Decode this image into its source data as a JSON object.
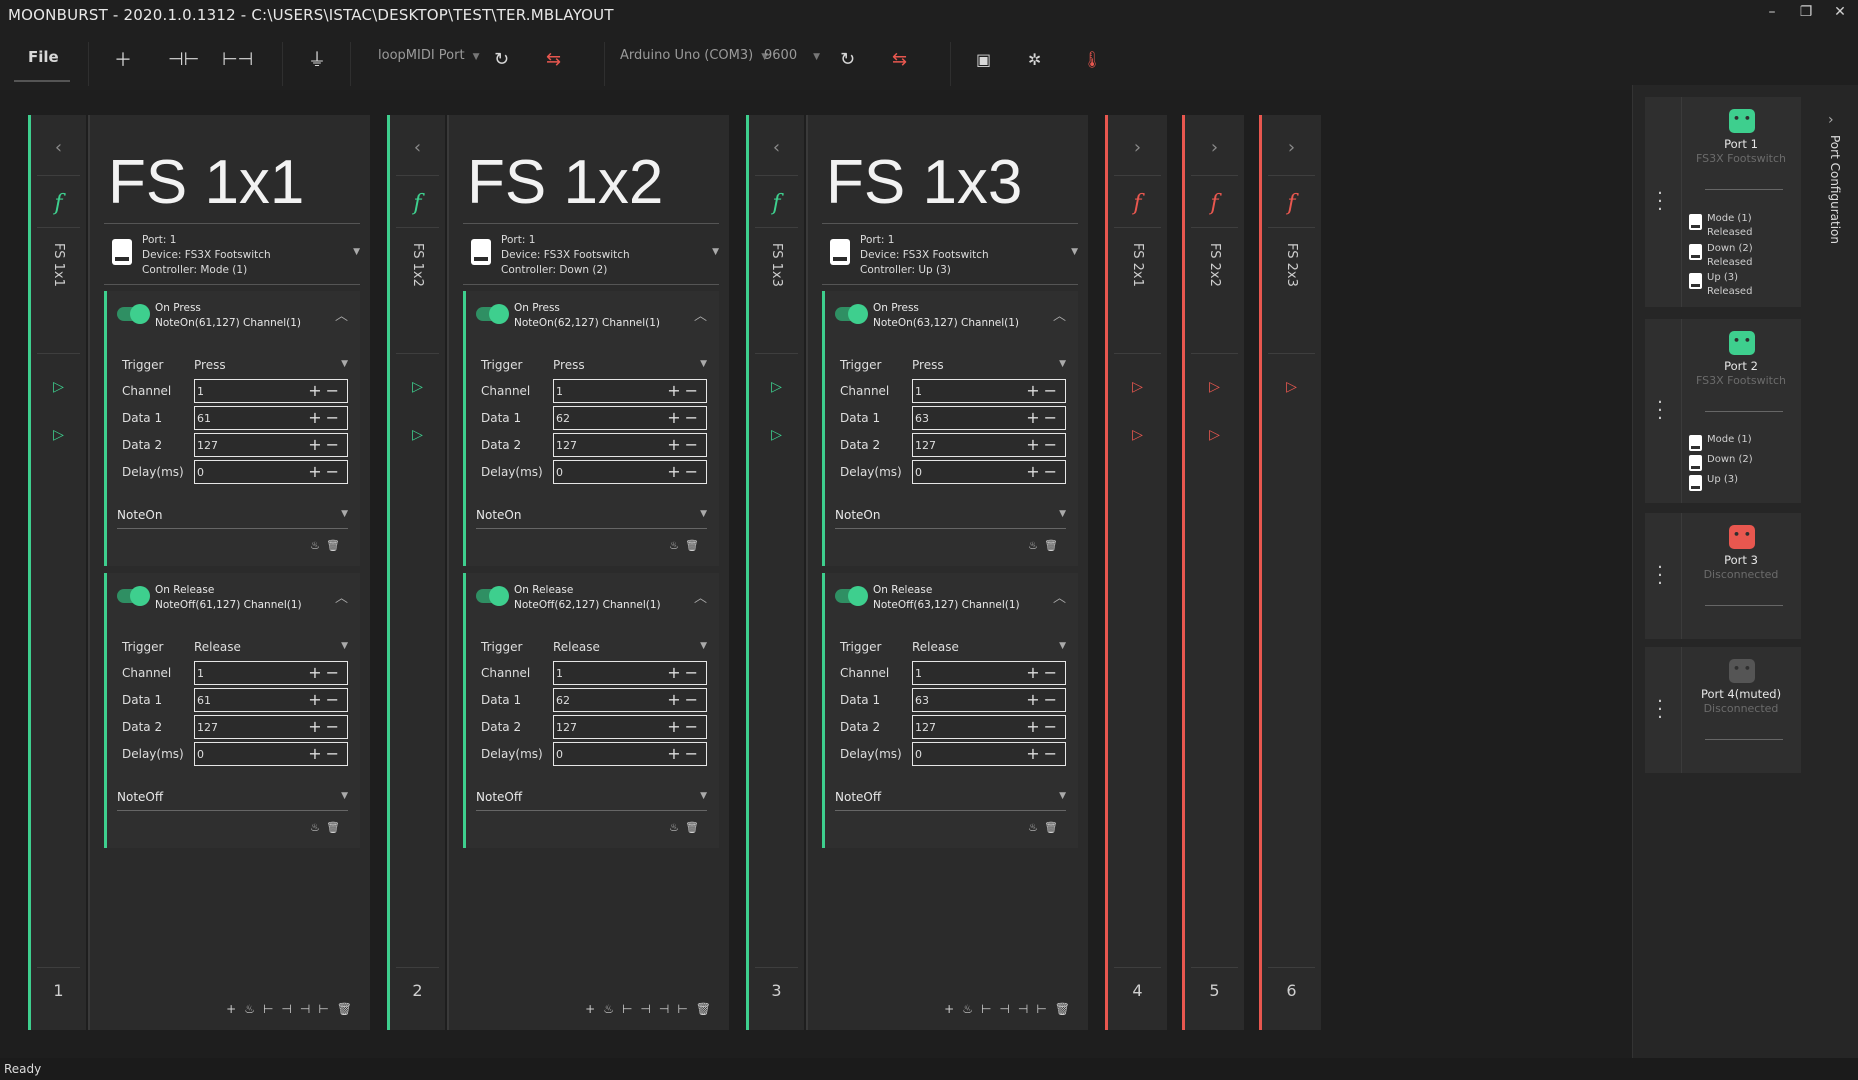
{
  "window": {
    "title": "MOONBURST - 2020.1.0.1312 - C:\\USERS\\ISTAC\\DESKTOP\\TEST\\TER.MBLAYOUT",
    "controls": [
      "–",
      "❐",
      "✕"
    ]
  },
  "toolbar": {
    "file_label": "File",
    "midi_port": "loopMIDI Port",
    "serial_port": "Arduino Uno (COM3)",
    "baud": "9600",
    "icons": [
      "add-icon",
      "split-icon",
      "fit-width-icon",
      "plug-icon",
      "refresh-icon",
      "swap-icon",
      "refresh-icon",
      "swap-icon",
      "calendar-alert-icon",
      "settings-bug-icon",
      "thermometer-icon"
    ]
  },
  "strips": [
    {
      "name": "FS 1x1",
      "number": "1",
      "state": "connected"
    },
    {
      "name": "FS 1x2",
      "number": "2",
      "state": "connected"
    },
    {
      "name": "FS 1x3",
      "number": "3",
      "state": "connected"
    },
    {
      "name": "FS 2x1",
      "number": "4",
      "state": "disconnected"
    },
    {
      "name": "FS 2x2",
      "number": "5",
      "state": "disconnected"
    },
    {
      "name": "FS 2x3",
      "number": "6",
      "state": "disconnected"
    }
  ],
  "panels": [
    {
      "title": "FS 1x1",
      "port": "Port: 1",
      "device": "Device: FS3X Footswitch",
      "controller": "Controller: Mode (1)",
      "actions": [
        {
          "name": "On Press",
          "msg": "NoteOn(61,127) Channel(1)",
          "trigger": "Press",
          "channel": "1",
          "data1": "61",
          "data2": "127",
          "delay": "0",
          "type": "NoteOn"
        },
        {
          "name": "On Release",
          "msg": "NoteOff(61,127) Channel(1)",
          "trigger": "Release",
          "channel": "1",
          "data1": "61",
          "data2": "127",
          "delay": "0",
          "type": "NoteOff"
        }
      ]
    },
    {
      "title": "FS 1x2",
      "port": "Port: 1",
      "device": "Device: FS3X Footswitch",
      "controller": "Controller: Down (2)",
      "actions": [
        {
          "name": "On Press",
          "msg": "NoteOn(62,127) Channel(1)",
          "trigger": "Press",
          "channel": "1",
          "data1": "62",
          "data2": "127",
          "delay": "0",
          "type": "NoteOn"
        },
        {
          "name": "On Release",
          "msg": "NoteOff(62,127) Channel(1)",
          "trigger": "Release",
          "channel": "1",
          "data1": "62",
          "data2": "127",
          "delay": "0",
          "type": "NoteOff"
        }
      ]
    },
    {
      "title": "FS 1x3",
      "port": "Port: 1",
      "device": "Device: FS3X Footswitch",
      "controller": "Controller: Up (3)",
      "actions": [
        {
          "name": "On Press",
          "msg": "NoteOn(63,127) Channel(1)",
          "trigger": "Press",
          "channel": "1",
          "data1": "63",
          "data2": "127",
          "delay": "0",
          "type": "NoteOn"
        },
        {
          "name": "On Release",
          "msg": "NoteOff(63,127) Channel(1)",
          "trigger": "Release",
          "channel": "1",
          "data1": "63",
          "data2": "127",
          "delay": "0",
          "type": "NoteOff"
        }
      ]
    }
  ],
  "labels": {
    "trigger": "Trigger",
    "channel": "Channel",
    "data1": "Data 1",
    "data2": "Data 2",
    "delay": "Delay(ms)"
  },
  "ports": [
    {
      "name": "Port 1",
      "device": "FS3X Footswitch",
      "color": "#3ecf8e",
      "controls": [
        [
          "Mode (1)",
          "Released"
        ],
        [
          "Down (2)",
          "Released"
        ],
        [
          "Up (3)",
          "Released"
        ]
      ]
    },
    {
      "name": "Port 2",
      "device": "FS3X Footswitch",
      "color": "#3ecf8e",
      "controls": [
        [
          "Mode (1)",
          ""
        ],
        [
          "Down (2)",
          ""
        ],
        [
          "Up (3)",
          ""
        ]
      ]
    },
    {
      "name": "Port 3",
      "device": "Disconnected",
      "color": "#e8574f",
      "controls": []
    },
    {
      "name": "Port 4(muted)",
      "device": "Disconnected",
      "color": "#555555",
      "controls": []
    }
  ],
  "port_configuration_label": "Port Configuration",
  "status": "Ready",
  "colors": {
    "accent_green": "#3ecf8e",
    "accent_red": "#e8574f"
  }
}
